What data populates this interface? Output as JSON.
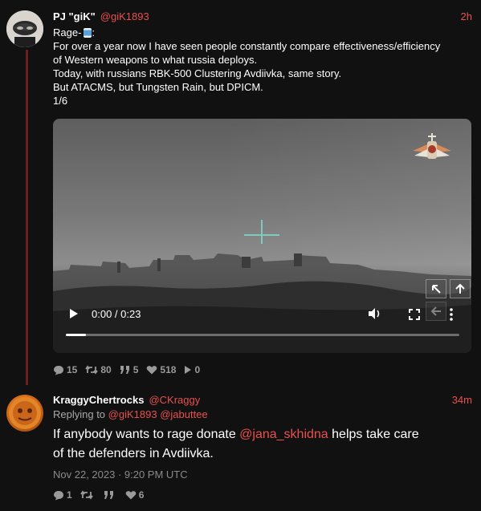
{
  "tweet1": {
    "display_name": "PJ \"giK\"",
    "handle": "@giK1893",
    "time": "2h",
    "lines": [
      "Rage-",
      "For over a year now I have seen people constantly compare effectiveness/efficiency",
      "of Western weapons to what russia deploys.",
      "Today, with russians RBK-500 Clustering Avdiivka, same story.",
      "But ATACMS, but Tungsten Rain, but DPICM.",
      "1/6"
    ],
    "video": {
      "time_display": "0:00 / 0:23",
      "progress": 0.05
    },
    "stats": {
      "replies": "15",
      "retweets": "80",
      "quotes": "5",
      "likes": "518",
      "views": "0"
    }
  },
  "tweet2": {
    "display_name": "KraggyChertrocks",
    "handle": "@CKraggy",
    "time": "34m",
    "replying_to_label": "Replying to",
    "replying_to": [
      "@giK1893",
      "@jabuttee"
    ],
    "text_before": "If anybody wants to rage donate ",
    "mention": "@jana_skhidna",
    "text_after_line1": " helps take care",
    "text_line2": "of the defenders in Avdiivka.",
    "date": "Nov 22, 2023 · 9:20 PM UTC",
    "stats": {
      "replies": "1",
      "retweets": "",
      "quotes": "",
      "likes": "6"
    }
  },
  "colors": {
    "background": "#111111",
    "accent": "#e8504f",
    "thread_line": "#6b1e1e"
  }
}
